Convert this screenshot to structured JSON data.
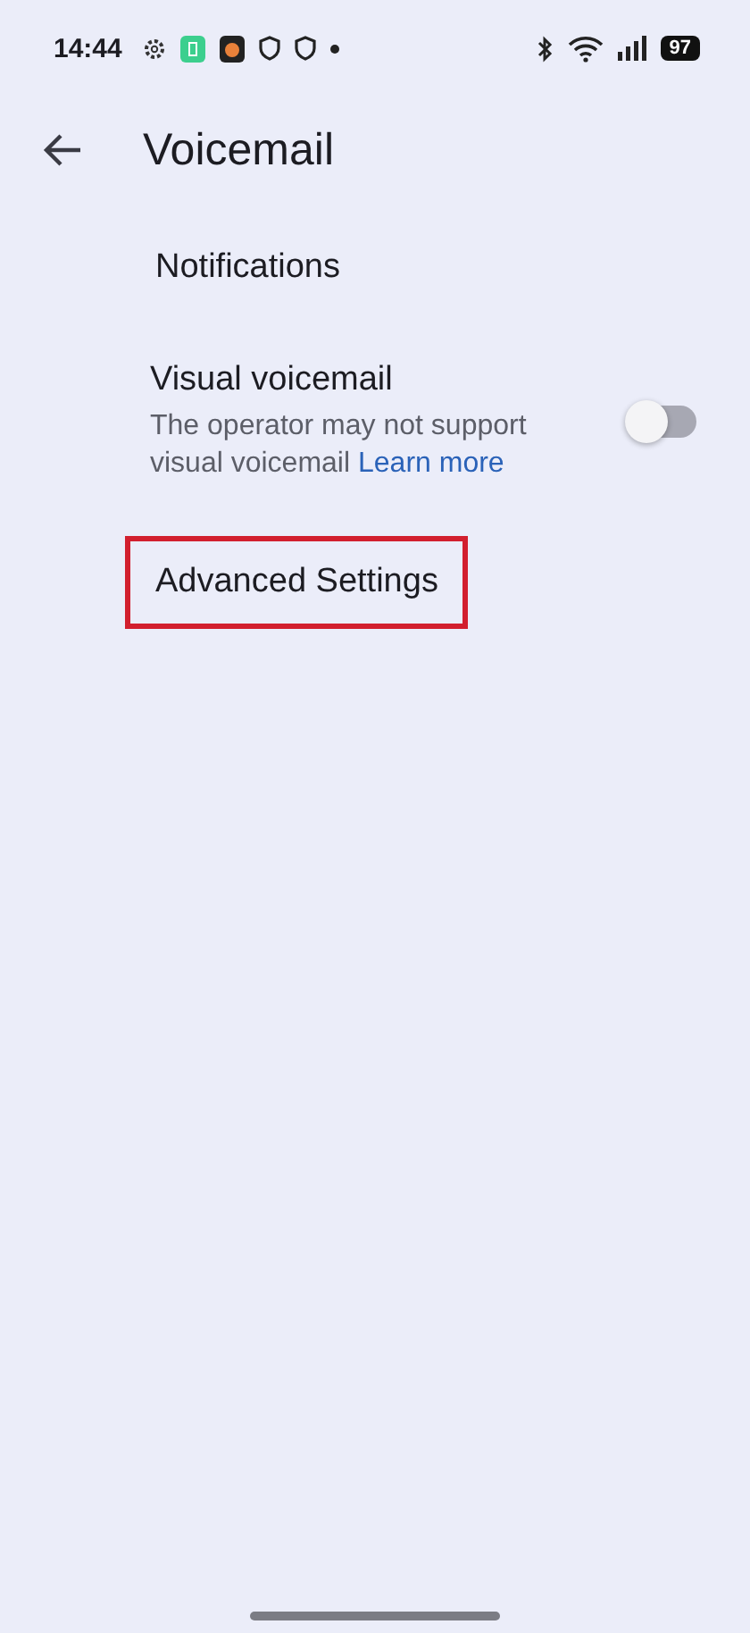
{
  "status_bar": {
    "time": "14:44",
    "battery": "97"
  },
  "header": {
    "title": "Voicemail"
  },
  "items": [
    {
      "kind": "link",
      "title": "Notifications",
      "highlighted": false
    },
    {
      "kind": "switch",
      "title": "Visual voicemail",
      "description": "The operator may not support visual voicemail",
      "link": "Learn more",
      "on": false
    },
    {
      "kind": "link",
      "title": "Advanced Settings",
      "highlighted": true
    }
  ]
}
